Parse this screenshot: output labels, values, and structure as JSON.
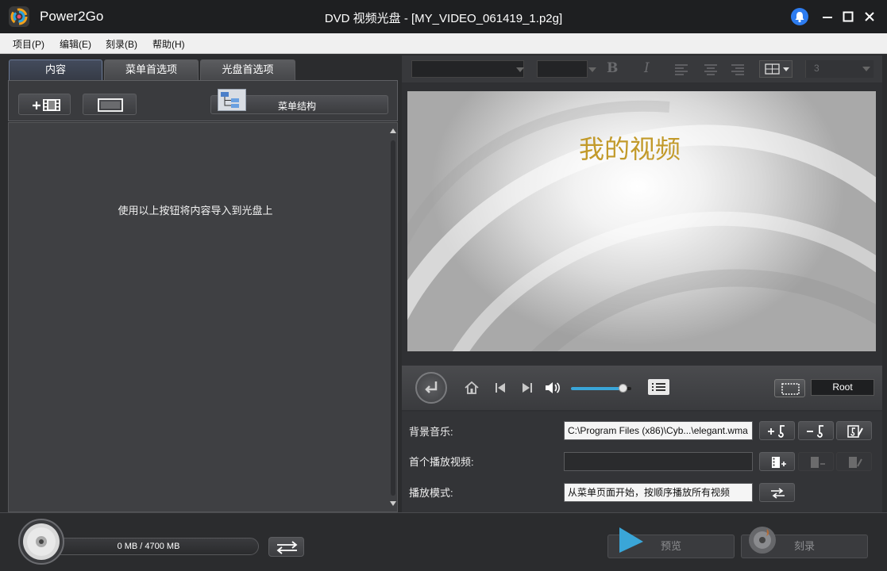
{
  "titlebar": {
    "app_name": "Power2Go",
    "window_title": "DVD 视频光盘 - [MY_VIDEO_061419_1.p2g]"
  },
  "menubar": {
    "items": [
      "项目(P)",
      "编辑(E)",
      "刻录(B)",
      "帮助(H)"
    ]
  },
  "left_panel": {
    "tabs": [
      "内容",
      "菜单首选项",
      "光盘首选项"
    ],
    "active_tab": "内容",
    "menu_structure_label": "菜单结构",
    "empty_hint": "使用以上按钮将内容导入到光盘上"
  },
  "format_toolbar": {
    "bold_label": "B",
    "italic_label": "I",
    "count_value": "3"
  },
  "preview": {
    "menu_title": "我的视频"
  },
  "playback": {
    "volume_level": 0.85,
    "root_label": "Root"
  },
  "settings": {
    "bgm_label": "背景音乐:",
    "bgm_value": "C:\\Program Files (x86)\\Cyb...\\elegant.wma",
    "first_play_label": "首个播放视频:",
    "first_play_value": "",
    "play_mode_label": "播放模式:",
    "play_mode_value": "从菜单页面开始，按顺序播放所有视频"
  },
  "bottom": {
    "capacity_text": "0 MB / 4700 MB",
    "preview_label": "预览",
    "burn_label": "刻录"
  },
  "colors": {
    "title_accent": "#c29a2a",
    "notify_blue": "#2d7cf0",
    "play_cyan": "#3aa6d8"
  }
}
